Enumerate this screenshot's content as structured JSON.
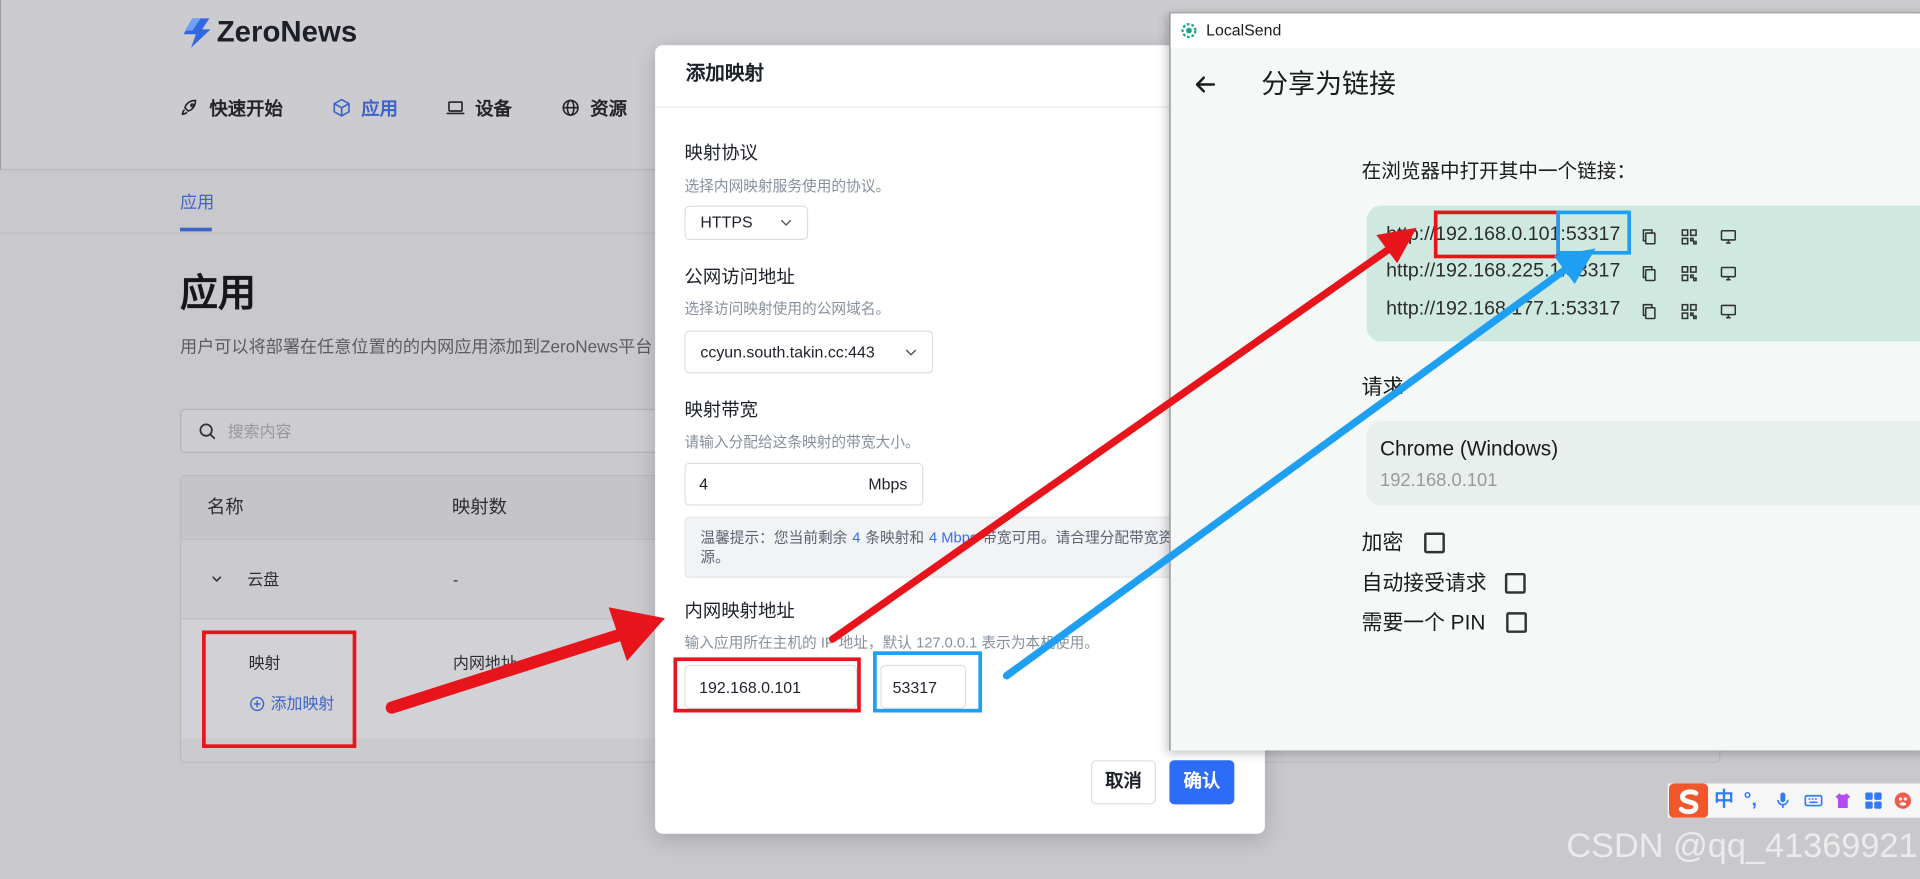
{
  "zeronews": {
    "logo_text": "ZeroNews",
    "nav": [
      {
        "label": "快速开始",
        "icon": "rocket-icon"
      },
      {
        "label": "应用",
        "icon": "cube-icon",
        "active": true
      },
      {
        "label": "设备",
        "icon": "laptop-icon"
      },
      {
        "label": "资源",
        "icon": "globe-icon"
      }
    ],
    "tab": "应用",
    "page_title": "应用",
    "page_subtitle": "用户可以将部署在任意位置的的内网应用添加到ZeroNews平台",
    "search_placeholder": "搜索内容",
    "table": {
      "columns": [
        "名称",
        "映射数"
      ],
      "rows": [
        {
          "name": "云盘",
          "mapping_count": "-",
          "expanded": true
        }
      ],
      "detail": {
        "label": "映射",
        "column": "内网地址",
        "add_label": "添加映射"
      }
    }
  },
  "modal": {
    "title": "添加映射",
    "protocol": {
      "label": "映射协议",
      "hint": "选择内网映射服务使用的协议。",
      "value": "HTTPS"
    },
    "public_address": {
      "label": "公网访问地址",
      "hint": "选择访问映射使用的公网域名。",
      "value": "ccyun.south.takin.cc:443"
    },
    "bandwidth": {
      "label": "映射带宽",
      "hint": "请输入分配给这条映射的带宽大小。",
      "value": "4",
      "unit": "Mbps"
    },
    "tip": {
      "prefix": "温馨提示：您当前剩余",
      "mappings_left": "4",
      "middle": "条映射和",
      "bandwidth_left": "4 Mbps",
      "suffix": "带宽可用。请合理分配带宽资源。"
    },
    "internal_address": {
      "label": "内网映射地址",
      "hint": "输入应用所在主机的 IP 地址，默认 127.0.0.1 表示为本机使用。",
      "ip": "192.168.0.101",
      "port": "53317"
    },
    "cancel_label": "取消",
    "confirm_label": "确认"
  },
  "localsend": {
    "window_title": "LocalSend",
    "page_title": "分享为链接",
    "instruction": "在浏览器中打开其中一个链接：",
    "links": [
      "http://192.168.0.101:53317",
      "http://192.168.225.1:53317",
      "http://192.168.177.1:53317"
    ],
    "link_actions": [
      "copy-icon",
      "qr-code-icon",
      "monitor-icon"
    ],
    "requests_label": "请求",
    "request": {
      "client": "Chrome (Windows)",
      "ip": "192.168.0.101"
    },
    "options": [
      {
        "label": "加密",
        "checked": false
      },
      {
        "label": "自动接受请求",
        "checked": false
      },
      {
        "label": "需要一个 PIN",
        "checked": false
      }
    ]
  },
  "ime": {
    "mode": "中",
    "punctuation": "°,",
    "icons": [
      "sogou-logo-icon",
      "microphone-icon",
      "keyboard-icon",
      "skin-icon",
      "toolbox-icon",
      "mascot-icon"
    ]
  },
  "watermark": "CSDN @qq_41369921",
  "colors": {
    "zeronews_accent": "#2c6cf6",
    "localsend_accent": "#1aa38a",
    "link_box": "#cfe9e1",
    "annotation_red": "#e8141b",
    "annotation_blue": "#1e9ff2"
  }
}
